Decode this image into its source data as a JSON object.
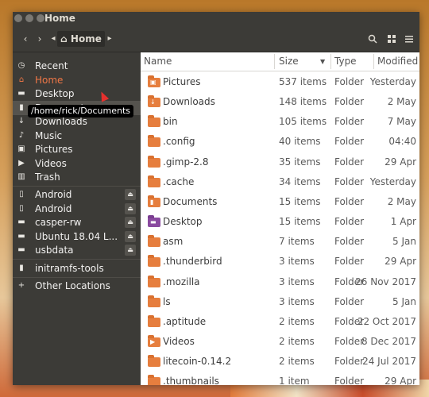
{
  "window": {
    "title": "Home"
  },
  "toolbar": {
    "back": "‹",
    "forward": "›",
    "path_left": "◂",
    "home_icon": "home-icon",
    "home_label": "Home",
    "path_right": "▸",
    "search_icon": "search-icon",
    "view_icon": "grid-icon",
    "menu_icon": "menu-icon"
  },
  "sidebar": {
    "items": [
      {
        "label": "Recent",
        "icon": "🕘"
      },
      {
        "label": "Home",
        "icon": "⌂"
      },
      {
        "label": "Desktop",
        "icon": "▬"
      },
      {
        "label": "Documents",
        "icon": "▮"
      },
      {
        "label": "Downloads",
        "icon": "↓"
      },
      {
        "label": "Music",
        "icon": "♪"
      },
      {
        "label": "Pictures",
        "icon": "▣"
      },
      {
        "label": "Videos",
        "icon": "▶"
      },
      {
        "label": "Trash",
        "icon": "🗑"
      }
    ],
    "devices": [
      {
        "label": "Android",
        "icon": "▯",
        "eject": "⏏"
      },
      {
        "label": "Android",
        "icon": "▯",
        "eject": "⏏"
      },
      {
        "label": "casper-rw",
        "icon": "▬",
        "eject": "⏏"
      },
      {
        "label": "Ubuntu 18.04 L...",
        "icon": "▬",
        "eject": "⏏"
      },
      {
        "label": "usbdata",
        "icon": "▬",
        "eject": "⏏"
      }
    ],
    "bookmarks": [
      {
        "label": "initramfs-tools",
        "icon": "▮"
      }
    ],
    "other": {
      "label": "Other Locations",
      "icon": "+"
    }
  },
  "tooltip": {
    "text": "/home/rick/Documents"
  },
  "columns": {
    "name": "Name",
    "size": "Size",
    "sort_icon": "▼",
    "type": "Type",
    "modified": "Modified"
  },
  "files": [
    {
      "name": "Pictures",
      "size": "537 items",
      "type": "Folder",
      "modified": "Yesterday",
      "glyph": "▣",
      "color": "orange"
    },
    {
      "name": "Downloads",
      "size": "148 items",
      "type": "Folder",
      "modified": "2 May",
      "glyph": "↓",
      "color": "orange"
    },
    {
      "name": "bin",
      "size": "105 items",
      "type": "Folder",
      "modified": "7 May",
      "glyph": "",
      "color": "orange"
    },
    {
      "name": ".config",
      "size": "40 items",
      "type": "Folder",
      "modified": "04:40",
      "glyph": "",
      "color": "orange"
    },
    {
      "name": ".gimp-2.8",
      "size": "35 items",
      "type": "Folder",
      "modified": "29 Apr",
      "glyph": "",
      "color": "orange"
    },
    {
      "name": ".cache",
      "size": "34 items",
      "type": "Folder",
      "modified": "Yesterday",
      "glyph": "",
      "color": "orange"
    },
    {
      "name": "Documents",
      "size": "15 items",
      "type": "Folder",
      "modified": "2 May",
      "glyph": "▮",
      "color": "orange"
    },
    {
      "name": "Desktop",
      "size": "15 items",
      "type": "Folder",
      "modified": "1 Apr",
      "glyph": "▬",
      "color": "purple"
    },
    {
      "name": "asm",
      "size": "7 items",
      "type": "Folder",
      "modified": "5 Jan",
      "glyph": "",
      "color": "orange"
    },
    {
      "name": ".thunderbird",
      "size": "3 items",
      "type": "Folder",
      "modified": "29 Apr",
      "glyph": "",
      "color": "orange"
    },
    {
      "name": ".mozilla",
      "size": "3 items",
      "type": "Folder",
      "modified": "26 Nov 2017",
      "glyph": "",
      "color": "orange"
    },
    {
      "name": "ls",
      "size": "3 items",
      "type": "Folder",
      "modified": "5 Jan",
      "glyph": "",
      "color": "orange"
    },
    {
      "name": ".aptitude",
      "size": "2 items",
      "type": "Folder",
      "modified": "22 Oct 2017",
      "glyph": "",
      "color": "orange"
    },
    {
      "name": "Videos",
      "size": "2 items",
      "type": "Folder",
      "modified": "8 Dec 2017",
      "glyph": "▶",
      "color": "orange"
    },
    {
      "name": "litecoin-0.14.2",
      "size": "2 items",
      "type": "Folder",
      "modified": "24 Jul 2017",
      "glyph": "",
      "color": "orange"
    },
    {
      "name": ".thumbnails",
      "size": "1 item",
      "type": "Folder",
      "modified": "29 Apr",
      "glyph": "",
      "color": "orange"
    }
  ],
  "colors": {
    "accent": "#f07746",
    "sidebar_bg": "#3c3b37",
    "folder": "#e67e3e"
  }
}
